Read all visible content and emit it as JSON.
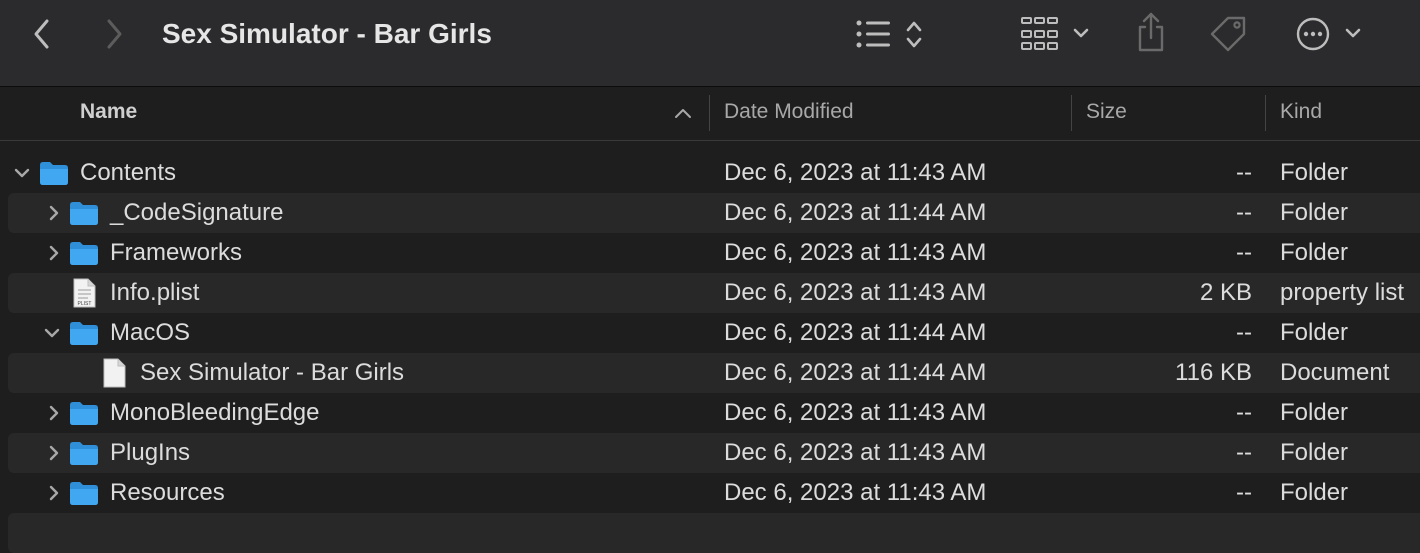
{
  "window": {
    "title": "Sex Simulator - Bar Girls"
  },
  "columns": {
    "name": "Name",
    "date": "Date Modified",
    "size": "Size",
    "kind": "Kind"
  },
  "rows": [
    {
      "name": "Contents",
      "date": "Dec 6, 2023 at 11:43 AM",
      "size": "--",
      "kind": "Folder",
      "icon": "folder-icon",
      "disclosure": "expanded"
    },
    {
      "name": "_CodeSignature",
      "date": "Dec 6, 2023 at 11:44 AM",
      "size": "--",
      "kind": "Folder",
      "icon": "folder-icon",
      "disclosure": "collapsed"
    },
    {
      "name": "Frameworks",
      "date": "Dec 6, 2023 at 11:43 AM",
      "size": "--",
      "kind": "Folder",
      "icon": "folder-icon",
      "disclosure": "collapsed"
    },
    {
      "name": "Info.plist",
      "date": "Dec 6, 2023 at 11:43 AM",
      "size": "2 KB",
      "kind": "property list",
      "icon": "plist-file-icon",
      "icon_label": "PLIST",
      "disclosure": "none"
    },
    {
      "name": "MacOS",
      "date": "Dec 6, 2023 at 11:44 AM",
      "size": "--",
      "kind": "Folder",
      "icon": "folder-icon",
      "disclosure": "expanded"
    },
    {
      "name": "Sex Simulator - Bar Girls",
      "date": "Dec 6, 2023 at 11:44 AM",
      "size": "116 KB",
      "kind": "Document",
      "icon": "document-icon",
      "disclosure": "none"
    },
    {
      "name": "MonoBleedingEdge",
      "date": "Dec 6, 2023 at 11:43 AM",
      "size": "--",
      "kind": "Folder",
      "icon": "folder-icon",
      "disclosure": "collapsed"
    },
    {
      "name": "PlugIns",
      "date": "Dec 6, 2023 at 11:43 AM",
      "size": "--",
      "kind": "Folder",
      "icon": "folder-icon",
      "disclosure": "collapsed"
    },
    {
      "name": "Resources",
      "date": "Dec 6, 2023 at 11:43 AM",
      "size": "--",
      "kind": "Folder",
      "icon": "folder-icon",
      "disclosure": "collapsed"
    }
  ],
  "colors": {
    "background": "#1e1e1e",
    "toolbar": "#2b2b2d",
    "stripe": "#282828",
    "folder": "#41a7f0",
    "text": "#dcdcdc",
    "header_text": "#a8a8a8"
  }
}
